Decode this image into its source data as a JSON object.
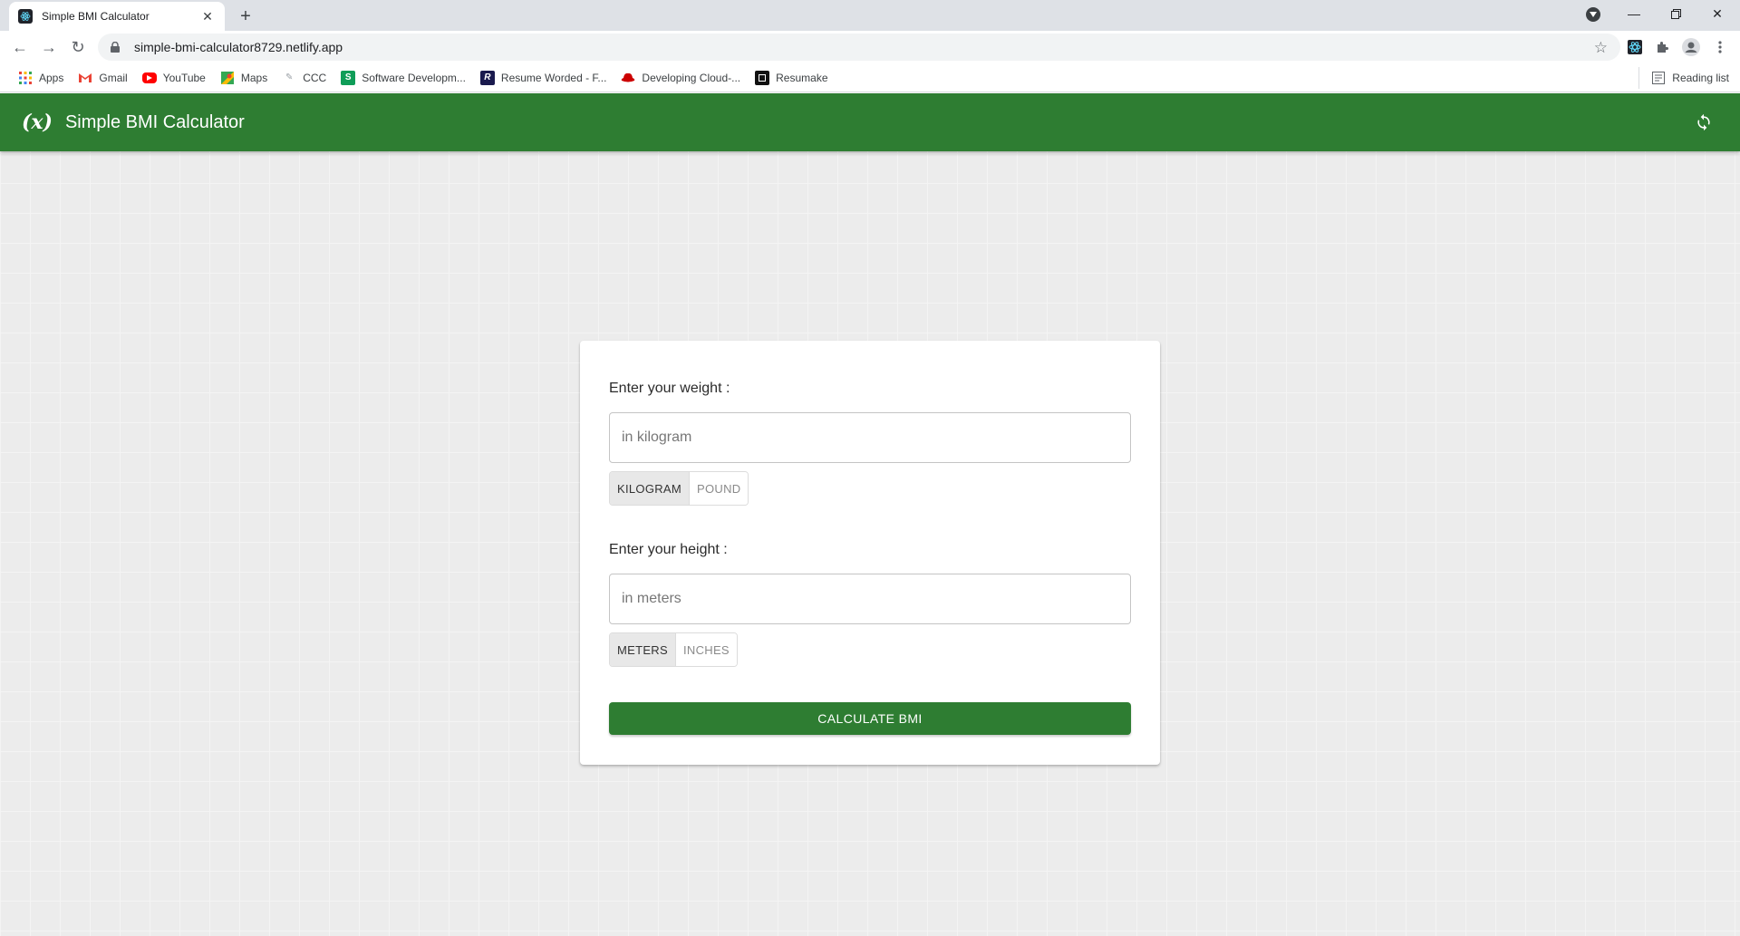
{
  "browser": {
    "tab_title": "Simple BMI Calculator",
    "url": "simple-bmi-calculator8729.netlify.app",
    "bookmarks": [
      {
        "label": "Apps",
        "icon": "apps-grid-icon",
        "color": "#ea4335"
      },
      {
        "label": "Gmail",
        "icon": "gmail-icon",
        "color": "#ea4335"
      },
      {
        "label": "YouTube",
        "icon": "youtube-icon",
        "color": "#ff0000"
      },
      {
        "label": "Maps",
        "icon": "maps-icon",
        "color": "#34a853"
      },
      {
        "label": "CCC",
        "icon": "ccc-icon",
        "color": "#9aa0a6"
      },
      {
        "label": "Software Developm...",
        "icon": "s-icon",
        "color": "#0f9d58"
      },
      {
        "label": "Resume Worded - F...",
        "icon": "r-icon",
        "color": "#1a1a4e"
      },
      {
        "label": "Developing Cloud-...",
        "icon": "redhat-icon",
        "color": "#cc0000"
      },
      {
        "label": "Resumake",
        "icon": "resumake-icon",
        "color": "#111111"
      }
    ],
    "reading_list": "Reading list"
  },
  "app": {
    "logo": "(x)",
    "title": "Simple BMI Calculator",
    "brand_color": "#2e7d32"
  },
  "form": {
    "weight_label": "Enter your weight :",
    "weight_placeholder": "in kilogram",
    "weight_units": [
      "KILOGRAM",
      "POUND"
    ],
    "weight_selected": "KILOGRAM",
    "height_label": "Enter your height :",
    "height_placeholder": "in meters",
    "height_units": [
      "METERS",
      "INCHES"
    ],
    "height_selected": "METERS",
    "submit_label": "CALCULATE BMI"
  }
}
